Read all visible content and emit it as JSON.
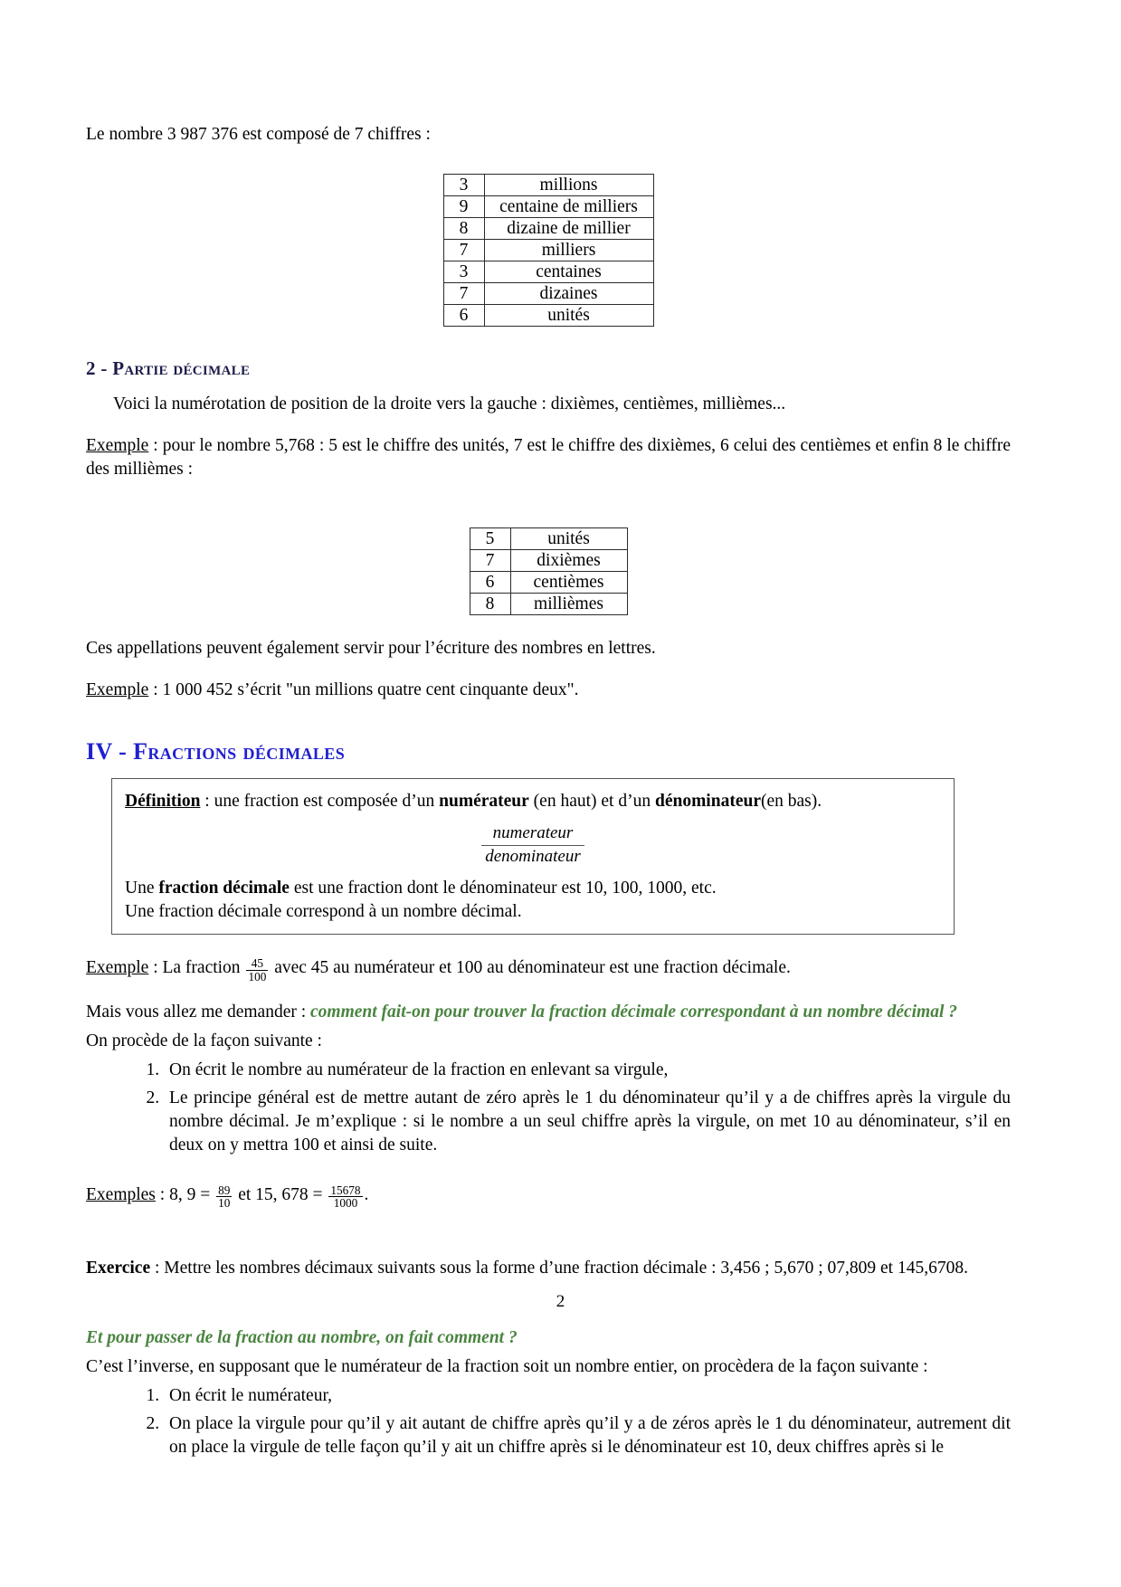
{
  "document": {
    "page_number": "2",
    "colors": {
      "heading_main": "#2020d0",
      "heading_sub": "#1b1b4b",
      "emphasis_green": "#4a8440",
      "text": "#000000",
      "rule": "#555555"
    }
  },
  "intro": {
    "text": "Le nombre 3 987 376 est composé de 7 chiffres :"
  },
  "table_integer": {
    "rows": [
      {
        "digit": "3",
        "name": "millions"
      },
      {
        "digit": "9",
        "name": "centaine de milliers"
      },
      {
        "digit": "8",
        "name": "dizaine de millier"
      },
      {
        "digit": "7",
        "name": "milliers"
      },
      {
        "digit": "3",
        "name": "centaines"
      },
      {
        "digit": "7",
        "name": "dizaines"
      },
      {
        "digit": "6",
        "name": "unités"
      }
    ]
  },
  "section_decimal_part": {
    "heading_number": "2 - ",
    "heading_title": "Partie décimale",
    "intro": "Voici la numérotation de position de la droite vers la gauche : dixièmes, centièmes, millièmes...",
    "example_label": "Exemple",
    "example_text": " : pour le nombre 5,768 : 5 est le chiffre des unités, 7 est le chiffre des dixièmes, 6 celui des centièmes et enfin 8 le chiffre des millièmes :"
  },
  "table_decimal": {
    "rows": [
      {
        "digit": "5",
        "name": "unités"
      },
      {
        "digit": "7",
        "name": "dixièmes"
      },
      {
        "digit": "6",
        "name": "centièmes"
      },
      {
        "digit": "8",
        "name": "millièmes"
      }
    ]
  },
  "after_table_decimal": {
    "text": "Ces appellations peuvent également servir pour l’écriture des nombres en lettres.",
    "example_label": "Exemple",
    "example_text": " : 1 000 452 s’écrit \"un millions quatre cent cinquante deux\"."
  },
  "section_fractions": {
    "heading_number": "IV - ",
    "heading_title": "Fractions décimales",
    "definition_box": {
      "label": "Définition",
      "line1_a": " : une fraction est composée d’un ",
      "line1_bold1": "numérateur",
      "line1_b": " (en haut) et d’un ",
      "line1_bold2": "dénominateur",
      "line1_c": "(en bas).",
      "fraction_numerator": "numerateur",
      "fraction_denominator": "denominateur",
      "line2_a": "Une ",
      "line2_bold": "fraction décimale",
      "line2_b": " est une fraction dont le dénominateur est 10, 100, 1000, etc.",
      "line3": "Une fraction décimale correspond à un nombre décimal."
    },
    "example_label": "Exemple",
    "example_a": " : La fraction ",
    "example_frac_num": "45",
    "example_frac_den": "100",
    "example_b": " avec 45 au numérateur et 100 au dénominateur est une fraction décimale.",
    "question_lead": "Mais vous allez me demander : ",
    "question_green": "comment fait-on pour trouver la fraction décimale correspondant à un nombre décimal ?",
    "procedure_lead": "On procède de la façon suivante :",
    "procedure_steps": [
      "On écrit le nombre au numérateur de la fraction en enlevant sa virgule,",
      "Le principe général est de mettre autant de zéro après le 1 du dénominateur qu’il y a de chiffres après la virgule du nombre décimal. Je m’explique : si le nombre a un seul chiffre après la virgule, on met 10 au dénominateur, s’il en deux on y mettra 100 et ainsi de suite."
    ],
    "examples_label": "Exemples",
    "examples_a": " : 8, 9 = ",
    "examples_frac1_num": "89",
    "examples_frac1_den": "10",
    "examples_b": " et 15, 678 = ",
    "examples_frac2_num": "15678",
    "examples_frac2_den": "1000",
    "examples_c": ".",
    "exercise_label": "Exercice",
    "exercise_text": " : Mettre les nombres décimaux suivants sous la forme d’une fraction décimale : 3,456 ; 5,670 ; 07,809 et 145,6708.",
    "reverse_green": "Et pour passer de la fraction au nombre, on fait comment ?",
    "reverse_lead": "C’est l’inverse, en supposant que le numérateur de la fraction soit un nombre entier, on procèdera de la façon suivante :",
    "reverse_steps": [
      "On écrit le numérateur,",
      "On place la virgule pour qu’il y ait autant de chiffre après qu’il y a de zéros après le 1 du dénominateur, autrement dit on place la virgule de telle façon qu’il y ait un chiffre après si le dénominateur est 10, deux chiffres après si le"
    ]
  }
}
